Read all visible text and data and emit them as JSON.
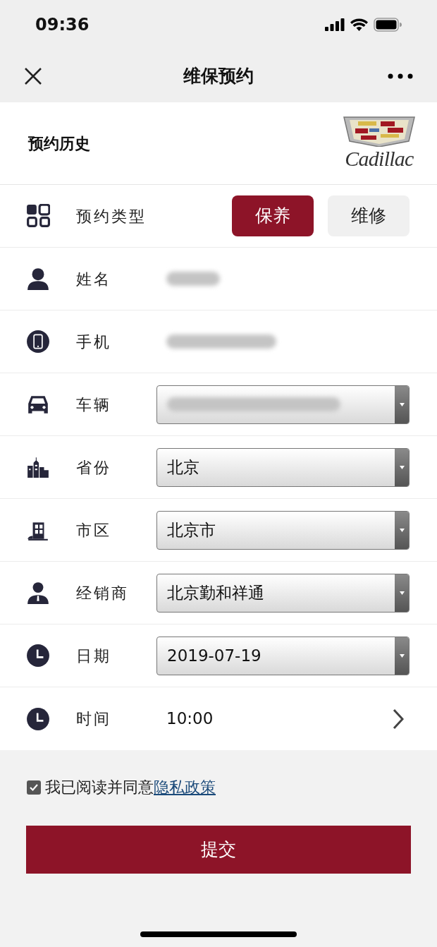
{
  "status_bar": {
    "time": "09:36"
  },
  "nav": {
    "title": "维保预约"
  },
  "header": {
    "title": "预约历史",
    "logo_text": "Cadillac"
  },
  "rows": [
    {
      "label": "预约类型",
      "kind": "toggle",
      "options": [
        {
          "label": "保养",
          "selected": true
        },
        {
          "label": "维修",
          "selected": false
        }
      ]
    },
    {
      "label": "姓名",
      "kind": "blurred"
    },
    {
      "label": "手机",
      "kind": "blurred"
    },
    {
      "label": "车辆",
      "kind": "select",
      "blurred": true
    },
    {
      "label": "省份",
      "kind": "select",
      "value": "北京"
    },
    {
      "label": "市区",
      "kind": "select",
      "value": "北京市"
    },
    {
      "label": "经销商",
      "kind": "select",
      "value": "北京勤和祥通"
    },
    {
      "label": "日期",
      "kind": "select",
      "value": "2019-07-19"
    },
    {
      "label": "时间",
      "kind": "link",
      "value": "10:00"
    }
  ],
  "agreement": {
    "checked": true,
    "text": "我已阅读并同意",
    "link": "隐私政策"
  },
  "submit": {
    "label": "提交"
  }
}
